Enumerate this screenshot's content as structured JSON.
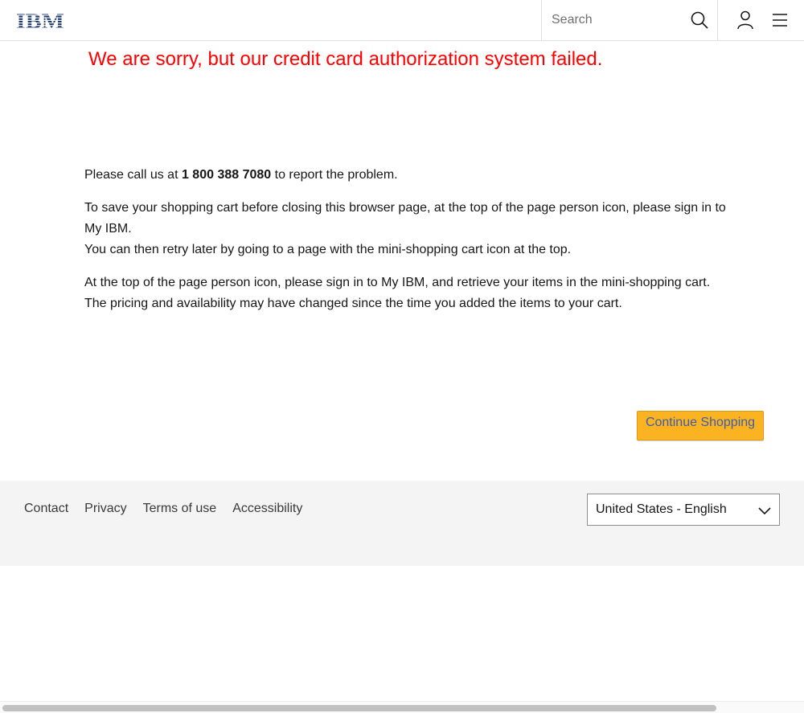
{
  "masthead": {
    "logo_text": "IBM",
    "logo_color": "#1f3a6e",
    "search": {
      "placeholder": "Search"
    },
    "icons": [
      "search-icon",
      "user-icon",
      "menu-icon"
    ]
  },
  "main": {
    "error_title": "We are sorry, but our credit card authorization system failed.",
    "error_color": "#ff0000",
    "call_prefix": "Please call us at ",
    "phone": "1 800 388 7080",
    "call_suffix": " to report the problem.",
    "save_cart_line1": "To save your shopping cart before closing this browser page, at the top of the page person icon, please sign in to My IBM.",
    "save_cart_line2": "You can then retry later by going to a page with the mini-shopping cart icon at the top.",
    "retrieve_line1": "At the top of the page person icon, please sign in to My IBM, and retrieve your items in the mini-shopping cart.",
    "retrieve_line2": "The pricing and availability may have changed since the time you added the items to your cart.",
    "continue_button": "Continue Shopping",
    "button_color": "#fbb321"
  },
  "footer": {
    "links": [
      "Contact",
      "Privacy",
      "Terms of use",
      "Accessibility"
    ],
    "locale": "United States - English"
  }
}
